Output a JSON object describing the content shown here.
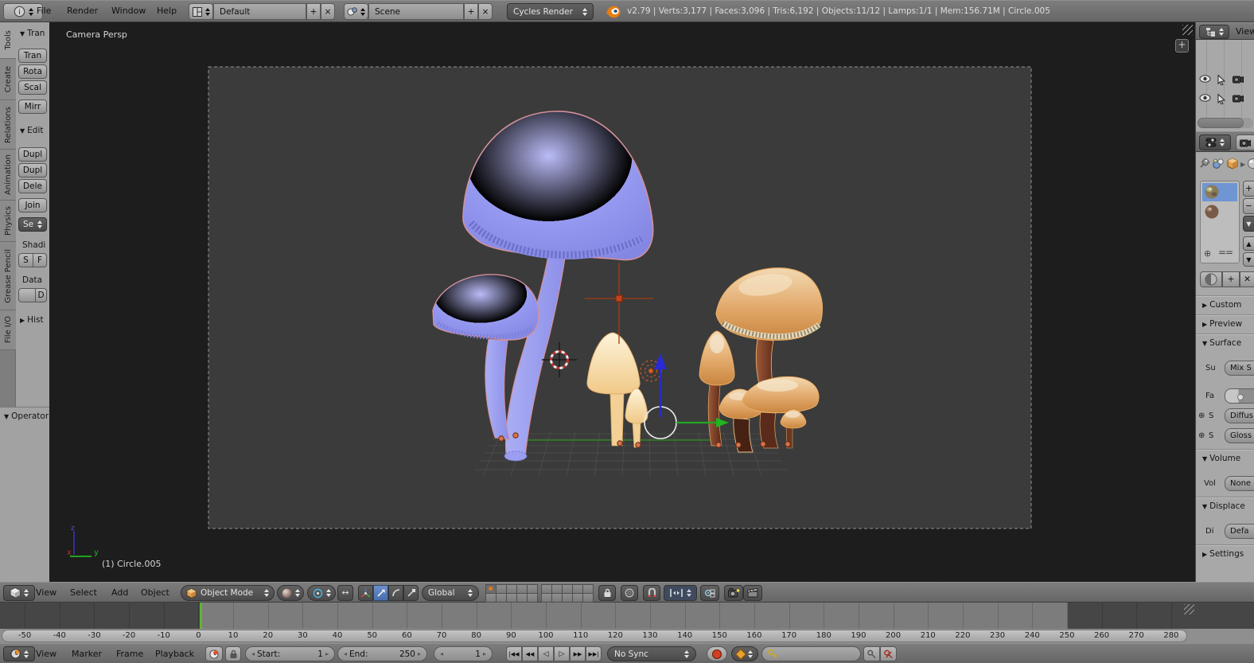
{
  "colors": {
    "playhead_green": "#5fb52f",
    "selection_orange": "#e8a050",
    "lamp_orange": "#c1451c",
    "blue_mushroom_cap": "#9193ee",
    "orange_mushroom_cap": "#e2a96b",
    "cream_mushroom_cap": "#f2cf94",
    "manipulator_blue": "#2a2ad0",
    "manipulator_green": "#22a622",
    "active_tool_blue": "#567fbf",
    "material_selected_blue": "#6f95d3"
  },
  "topbar": {
    "menus": [
      "File",
      "Render",
      "Window",
      "Help"
    ],
    "layout_value": "Default",
    "scene_value": "Scene",
    "engine_value": "Cycles Render",
    "stats": "v2.79 | Verts:3,177 | Faces:3,096 | Tris:6,192 | Objects:11/12 | Lamps:1/1 | Mem:156.71M | Circle.005"
  },
  "toolshelf": {
    "tabs": [
      "Tools",
      "Create",
      "Relations",
      "Animation",
      "Physics",
      "Grease Pencil",
      "File I/O"
    ],
    "panel_transform": "Tran",
    "btn_translate": "Tran",
    "btn_rotate": "Rota",
    "btn_scale": "Scal",
    "btn_mirror": "Mirr",
    "panel_edit": "Edit",
    "btn_duplicate": "Dupl",
    "btn_duplicate_linked": "Dupl",
    "btn_delete": "Dele",
    "btn_join": "Join",
    "btn_set_origin": "Se",
    "label_shading": "Shadi",
    "btn_smooth": "S",
    "btn_flat": "F",
    "label_data": "Data",
    "btn_data": "D",
    "panel_history": "Hist",
    "panel_operator": "Operator"
  },
  "viewport": {
    "view_label": "Camera Persp",
    "object_label": "(1) Circle.005",
    "axis_x": "x",
    "axis_y": "y",
    "axis_z": "z"
  },
  "view3d_header": {
    "menus": [
      "View",
      "Select",
      "Add",
      "Object"
    ],
    "mode_value": "Object Mode",
    "orientation_value": "Global"
  },
  "outliner": {
    "menu": "View"
  },
  "properties": {
    "panel_custom": "Custom",
    "panel_preview": "Preview",
    "panel_surface": "Surface",
    "label_surface": "Su",
    "surface_value": "Mix S",
    "label_fac": "Fa",
    "label_shader1": "S",
    "shader1_value": "Diffus",
    "label_shader2": "S",
    "shader2_value": "Gloss",
    "panel_volume": "Volume",
    "label_volume": "Vol",
    "volume_value": "None",
    "panel_displace": "Displace",
    "label_displace": "Di",
    "displace_value": "Defa",
    "panel_settings": "Settings"
  },
  "timeline": {
    "menus": [
      "View",
      "Marker",
      "Frame",
      "Playback"
    ],
    "start_label": "Start:",
    "start_value": "1",
    "end_label": "End:",
    "end_value": "250",
    "frame_value": "1",
    "sync_value": "No Sync",
    "ruler_start": -50,
    "ruler_end": 280,
    "ruler_step": 10
  }
}
